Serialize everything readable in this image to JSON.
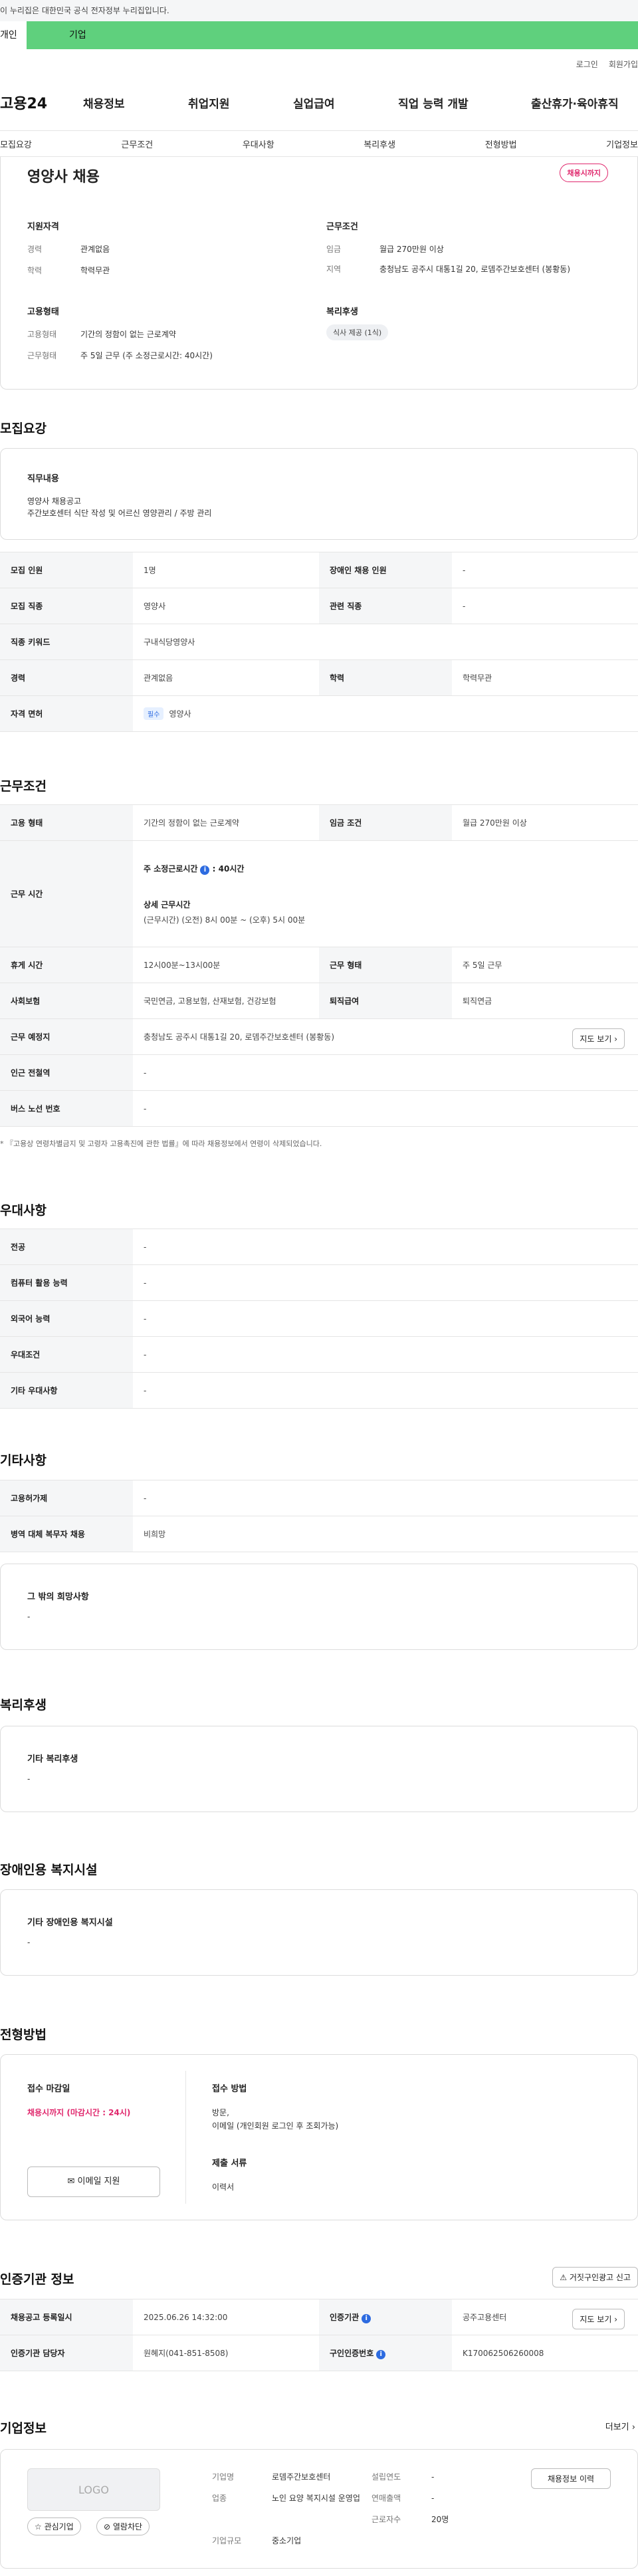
{
  "gov_banner": "이 누리집은 대한민국 공식 전자정부 누리집입니다.",
  "tabs": [
    "개인",
    "기업"
  ],
  "util": [
    "로그인",
    "회원가입"
  ],
  "logo": "고용24",
  "gnb": [
    "채용정보",
    "취업지원",
    "실업급여",
    "직업 능력 개발",
    "출산휴가·육아휴직"
  ],
  "subnav": [
    "모집요강",
    "근무조건",
    "우대사항",
    "복리후생",
    "전형방법",
    "기업정보"
  ],
  "job": {
    "title": "영양사 채용",
    "badge": "채용시까지",
    "qual_title": "지원자격",
    "qual": [
      {
        "k": "경력",
        "v": "관계없음"
      },
      {
        "k": "학력",
        "v": "학력무관"
      }
    ],
    "cond_title": "근무조건",
    "cond": [
      {
        "k": "임금",
        "v": "월급 270만원 이상"
      },
      {
        "k": "지역",
        "v": "충청남도 공주시 대통1길 20, 로뎀주간보호센터 (봉황동)"
      }
    ],
    "emp_title": "고용형태",
    "emp": [
      {
        "k": "고용형태",
        "v": "기간의 정함이 없는 근로계약"
      },
      {
        "k": "근무형태",
        "v": "주 5일 근무 (주 소정근로시간: 40시간)"
      }
    ],
    "welfare_title": "복리후생",
    "welfare_pill": "식사 제공 (1식)"
  },
  "recruit": {
    "h": "모집요강",
    "duty_title": "직무내용",
    "duty_lines": [
      "영양사 채용공고",
      "주간보호센터 식단 작성 및 어르신 영양관리 / 주방 관리"
    ],
    "rows": [
      [
        "모집 인원",
        "1명",
        "장애인 채용 인원",
        "-"
      ],
      [
        "모집 직종",
        "영양사",
        "관련 직종",
        "-"
      ],
      [
        "직종 키워드",
        "구내식당영양사",
        "",
        ""
      ],
      [
        "경력",
        "관계없음",
        "학력",
        "학력무관"
      ],
      [
        "자격 면허",
        "영양사",
        "",
        ""
      ]
    ],
    "license_tag": "필수"
  },
  "work": {
    "h": "근무조건",
    "r1": [
      "고용 형태",
      "기간의 정함이 없는 근로계약",
      "임금 조건",
      "월급 270만원 이상"
    ],
    "time_h": "근무 시간",
    "weekly_label": "주 소정근로시간",
    "weekly_val": ": 40시간",
    "detail_label": "상세 근무시간",
    "detail_val": "(근무시간) (오전) 8시 00분 ~ (오후) 5시 00분",
    "r3": [
      "휴게 시간",
      "12시00분~13시00분",
      "근무 형태",
      "주 5일 근무"
    ],
    "r4": [
      "사회보험",
      "국민연금, 고용보험, 산재보험, 건강보험",
      "퇴직급여",
      "퇴직연금"
    ],
    "r5": [
      "근무 예정지",
      "충청남도 공주시 대통1길 20, 로뎀주간보호센터 (봉황동)"
    ],
    "map_btn": "지도 보기",
    "r6": [
      "인근 전철역",
      "-"
    ],
    "r7": [
      "버스 노선 번호",
      "-"
    ],
    "note": "* 『고용상 연령차별금지 및 고령자 고용촉진에 관한 법률』에 따라 채용정보에서 연령이 삭제되었습니다."
  },
  "pref": {
    "h": "우대사항",
    "rows": [
      [
        "전공",
        "-"
      ],
      [
        "컴퓨터 활용 능력",
        "-"
      ],
      [
        "외국어 능력",
        "-"
      ],
      [
        "우대조건",
        "-"
      ],
      [
        "기타 우대사항",
        "-"
      ]
    ]
  },
  "etc": {
    "h": "기타사항",
    "rows": [
      [
        "고용허가제",
        "-"
      ],
      [
        "병역 대체 복무자 채용",
        "비희망"
      ]
    ],
    "box_title": "그 밖의 희망사항",
    "box_val": "-"
  },
  "benefit": {
    "h": "복리후생",
    "box_title": "기타 복리후생",
    "box_val": "-"
  },
  "disab": {
    "h": "장애인용 복지시설",
    "box_title": "기타 장애인용 복지시설",
    "box_val": "-"
  },
  "process": {
    "h": "전형방법",
    "deadline_title": "접수 마감일",
    "deadline_val": "채용시까지 (마감시간 : 24시)",
    "method_title": "접수 방법",
    "method_lines": [
      "방문,",
      "이메일 (개인회원 로그인 후 조회가능)"
    ],
    "docs_title": "제출 서류",
    "docs_val": "이력서",
    "email_btn": "이메일 지원"
  },
  "cert": {
    "h": "인증기관 정보",
    "report_btn": "거짓구인광고 신고",
    "r1": [
      "채용공고 등록일시",
      "2025.06.26 14:32:00",
      "인증기관",
      "공주고용센터"
    ],
    "r2": [
      "인증기관 담당자",
      "원혜지(041-851-8508)",
      "구인인증번호",
      "K170062506260008"
    ],
    "map_btn": "지도 보기"
  },
  "company": {
    "h": "기업정보",
    "more": "더보기",
    "logo": "LOGO",
    "fav": "관심기업",
    "block": "열람차단",
    "f": [
      [
        "기업명",
        "로뎀주간보호센터"
      ],
      [
        "업종",
        "노인 요양 복지시설 운영업"
      ],
      [
        "기업규모",
        "중소기업"
      ]
    ],
    "g": [
      [
        "설립연도",
        "-"
      ],
      [
        "연매출액",
        "-"
      ],
      [
        "근로자수",
        "20명"
      ]
    ],
    "history_btn": "채용정보 이력"
  }
}
